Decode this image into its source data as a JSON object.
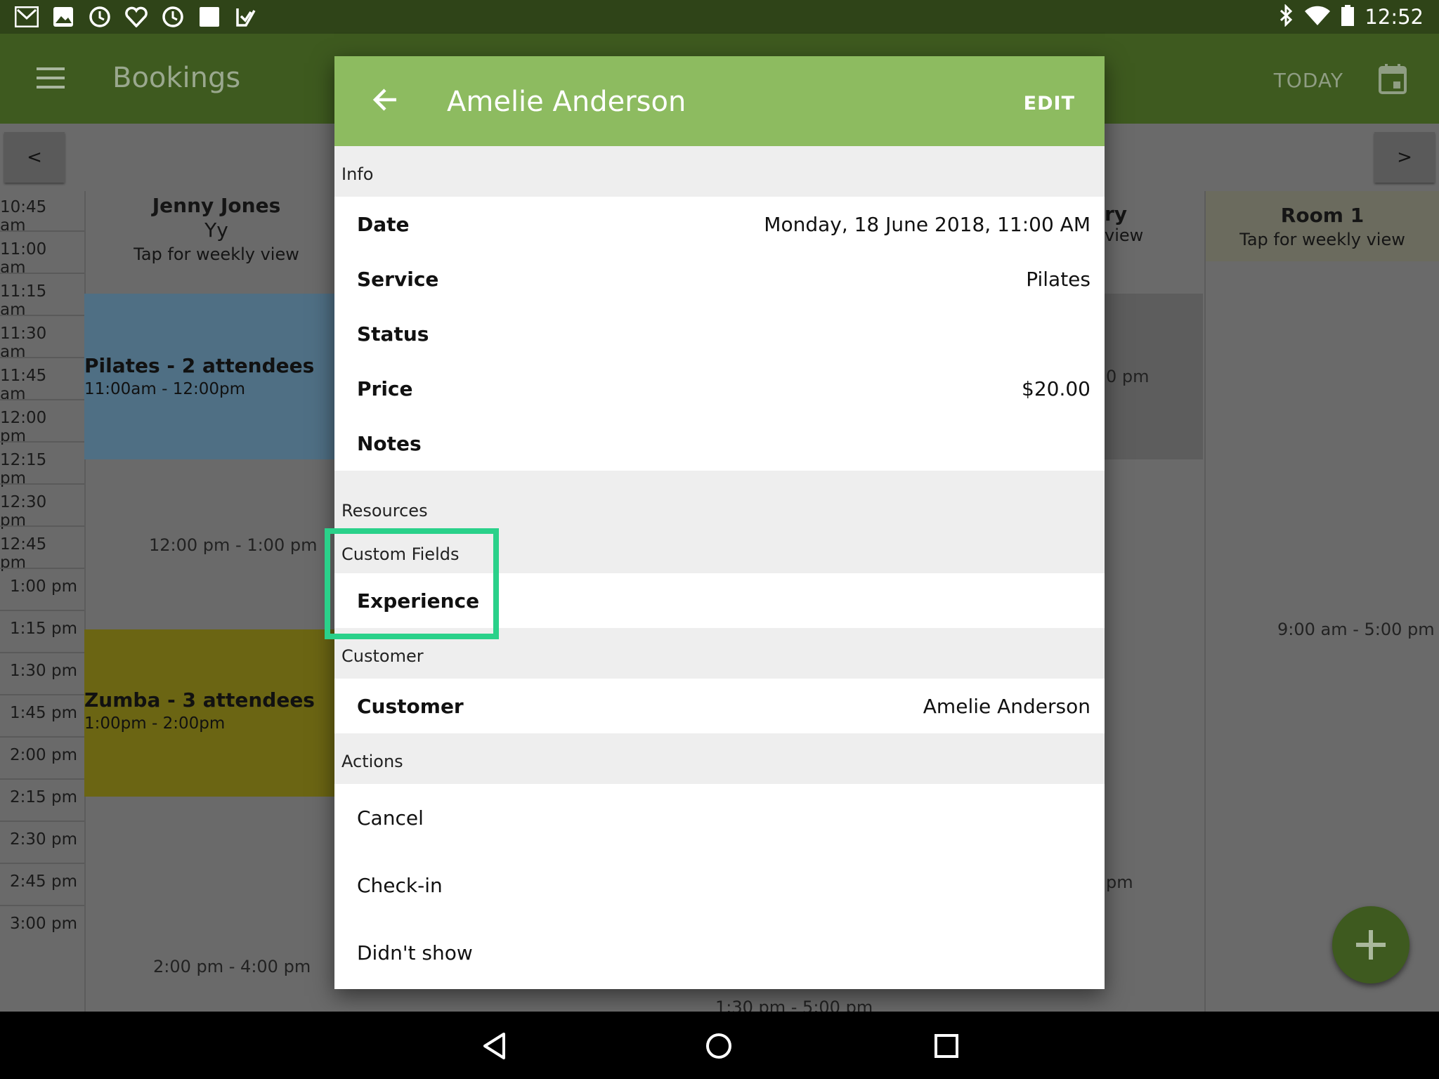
{
  "status_bar": {
    "time": "12:52",
    "left_icons": [
      "gmail-icon",
      "photos-icon",
      "clock-icon",
      "heart-icon",
      "alarm-icon",
      "square-icon",
      "checkmark-icon"
    ],
    "right_icons": [
      "bluetooth-icon",
      "wifi-icon",
      "battery-icon"
    ]
  },
  "app_bar": {
    "title": "Bookings",
    "today_label": "TODAY"
  },
  "day_nav": {
    "prev_label": "<",
    "next_label": ">"
  },
  "calendar": {
    "times": [
      "10:45 am",
      "11:00 am",
      "11:15 am",
      "11:30 am",
      "11:45 am",
      "12:00 pm",
      "12:15 pm",
      "12:30 pm",
      "12:45 pm",
      "1:00 pm",
      "1:15 pm",
      "1:30 pm",
      "1:45 pm",
      "2:00 pm",
      "2:15 pm",
      "2:30 pm",
      "2:45 pm",
      "3:00 pm"
    ],
    "columns": [
      {
        "name": "Jenny Jones",
        "name2": "Yy",
        "sub": "Tap for weekly view"
      },
      {
        "name": "ry",
        "sub": "view"
      },
      {
        "name": "Room 1",
        "sub": "Tap for weekly view"
      }
    ],
    "events": [
      {
        "title": "Pilates - 2 attendees",
        "time": "11:00am - 12:00pm",
        "color": "#4f6f84"
      },
      {
        "title": "Zumba - 3 attendees",
        "time": "1:00pm - 2:00pm",
        "color": "#6b6513"
      }
    ],
    "slots": {
      "jenny_noon": "12:00 pm - 1:00 pm",
      "jenny_two": "2:00 pm - 4:00 pm",
      "room_day": "9:00 am - 5:00 pm",
      "col2_a": "0 pm",
      "col2_b": "pm",
      "col_bottom": "1:30 pm - 5:00 pm"
    }
  },
  "dialog": {
    "title": "Amelie Anderson",
    "edit_label": "EDIT",
    "sections": {
      "info": "Info",
      "resources": "Resources",
      "custom_fields": "Custom Fields",
      "customer": "Customer",
      "actions": "Actions"
    },
    "info_rows": [
      {
        "label": "Date",
        "value": "Monday, 18 June 2018, 11:00 AM"
      },
      {
        "label": "Service",
        "value": "Pilates"
      },
      {
        "label": "Status",
        "value": ""
      },
      {
        "label": "Price",
        "value": "$20.00"
      },
      {
        "label": "Notes",
        "value": ""
      }
    ],
    "custom_rows": [
      {
        "label": "Experience",
        "value": ""
      }
    ],
    "customer_rows": [
      {
        "label": "Customer",
        "value": "Amelie Anderson"
      }
    ],
    "actions": [
      "Cancel",
      "Check-in",
      "Didn't show"
    ]
  },
  "colors": {
    "status_bar": "#2f4418",
    "app_bar": "#3e5a1f",
    "dialog_header": "#8dbb60",
    "highlight": "#2ad18a"
  }
}
